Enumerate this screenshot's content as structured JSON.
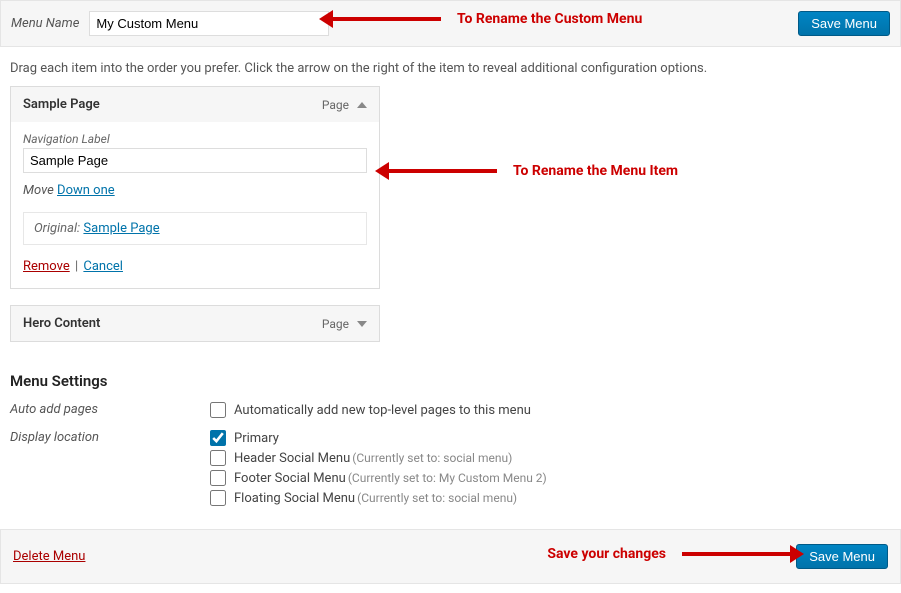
{
  "topbar": {
    "menu_name_label": "Menu Name",
    "menu_name_value": "My Custom Menu",
    "save_label": "Save Menu"
  },
  "instructions": "Drag each item into the order you prefer. Click the arrow on the right of the item to reveal additional configuration options.",
  "item1": {
    "title": "Sample Page",
    "type": "Page",
    "nav_label_caption": "Navigation Label",
    "nav_label_value": "Sample Page",
    "move_label": "Move",
    "move_down": "Down one",
    "original_label": "Original:",
    "original_link": "Sample Page",
    "remove": "Remove",
    "cancel": "Cancel"
  },
  "item2": {
    "title": "Hero Content",
    "type": "Page"
  },
  "settings": {
    "heading": "Menu Settings",
    "auto_add_label": "Auto add pages",
    "auto_add_text": "Automatically add new top-level pages to this menu",
    "display_location_label": "Display location",
    "loc_primary": "Primary",
    "loc_header": "Header Social Menu",
    "loc_header_note": "(Currently set to: social menu)",
    "loc_footer": "Footer Social Menu",
    "loc_footer_note": "(Currently set to: My Custom Menu 2)",
    "loc_floating": "Floating Social Menu",
    "loc_floating_note": "(Currently set to: social menu)"
  },
  "bottom": {
    "delete_menu": "Delete Menu",
    "save_label": "Save Menu"
  },
  "annotations": {
    "rename_menu": "To Rename the Custom Menu",
    "rename_item": "To Rename the Menu Item",
    "save_changes": "Save your changes"
  }
}
